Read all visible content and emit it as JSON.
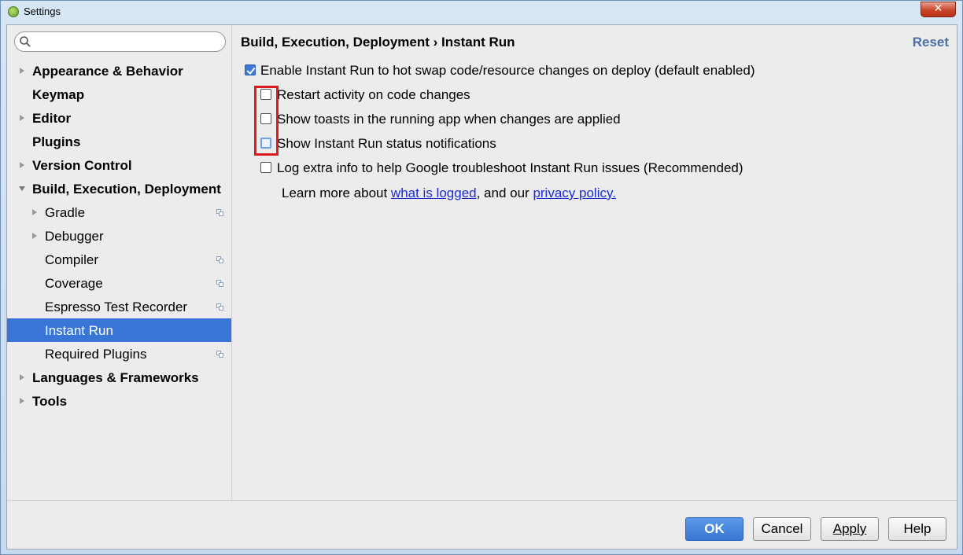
{
  "window": {
    "title": "Settings",
    "close_label": "✕"
  },
  "search": {
    "value": "",
    "placeholder": ""
  },
  "sidebar": {
    "items": [
      {
        "label": "Appearance & Behavior"
      },
      {
        "label": "Keymap"
      },
      {
        "label": "Editor"
      },
      {
        "label": "Plugins"
      },
      {
        "label": "Version Control"
      },
      {
        "label": "Build, Execution, Deployment"
      },
      {
        "label": "Gradle"
      },
      {
        "label": "Debugger"
      },
      {
        "label": "Compiler"
      },
      {
        "label": "Coverage"
      },
      {
        "label": "Espresso Test Recorder"
      },
      {
        "label": "Instant Run"
      },
      {
        "label": "Required Plugins"
      },
      {
        "label": "Languages & Frameworks"
      },
      {
        "label": "Tools"
      }
    ]
  },
  "content": {
    "breadcrumb": "Build, Execution, Deployment › Instant Run",
    "reset_label": "Reset",
    "options": [
      {
        "label": "Enable Instant Run to hot swap code/resource changes on deploy (default enabled)",
        "checked": true
      },
      {
        "label": "Restart activity on code changes",
        "checked": false
      },
      {
        "label": "Show toasts in the running app when changes are applied",
        "checked": false
      },
      {
        "label": "Show Instant Run status notifications",
        "checked": false
      },
      {
        "label": "Log extra info to help Google troubleshoot Instant Run issues (Recommended)",
        "checked": false
      }
    ],
    "learn_more": {
      "prefix": "Learn more about ",
      "link1": "what is logged",
      "middle": ", and our ",
      "link2": "privacy policy."
    }
  },
  "buttons": {
    "ok": "OK",
    "cancel": "Cancel",
    "apply": "Apply",
    "help": "Help"
  },
  "colors": {
    "selection": "#3875d7",
    "highlight": "#e01a22",
    "link": "#1b2bd6",
    "reset": "#4a6fa8"
  }
}
